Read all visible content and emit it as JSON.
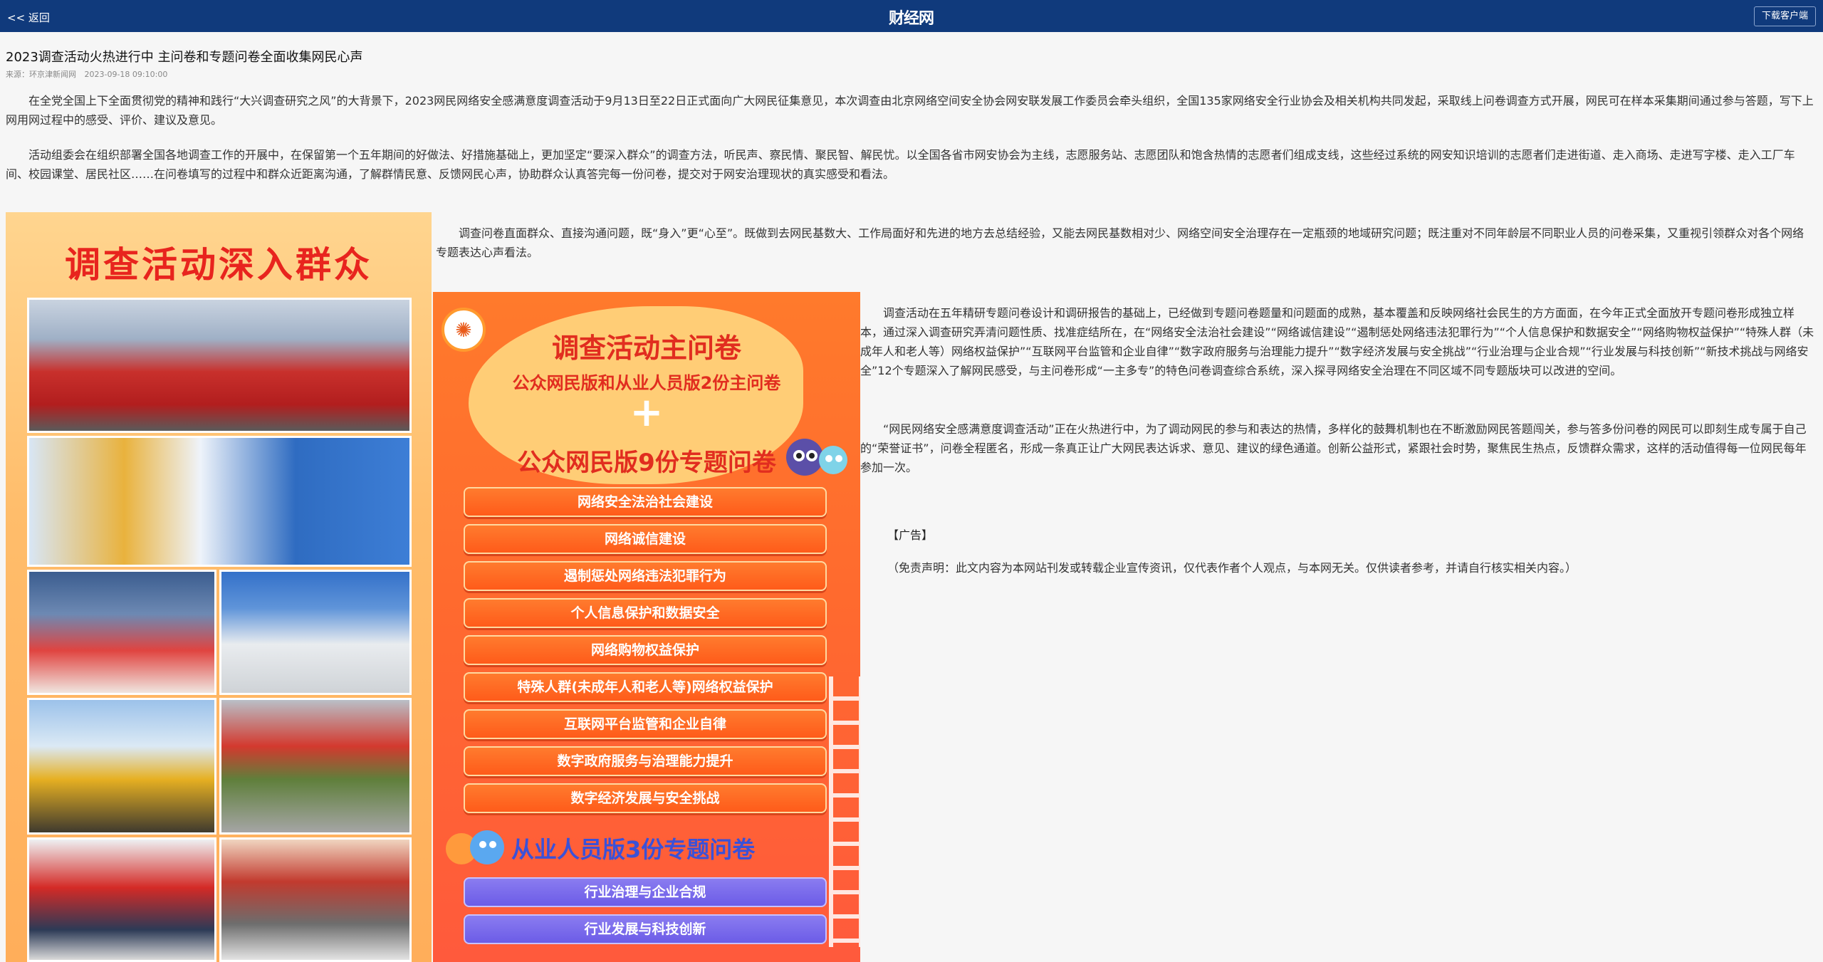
{
  "topbar": {
    "back_label": "<< 返回",
    "logo": "财经网",
    "download_label": "下载客户端"
  },
  "article": {
    "title": "2023调查活动火热进行中 主问卷和专题问卷全面收集网民心声",
    "source": "来源：环京津新闻网",
    "datetime": "2023-09-18 09:10:00",
    "paragraphs": [
      "在全党全国上下全面贯彻党的精神和践行“大兴调查研究之风”的大背景下，2023网民网络安全感满意度调查活动于9月13日至22日正式面向广大网民征集意见，本次调查由北京网络空间安全协会网安联发展工作委员会牵头组织，全国135家网络安全行业协会及相关机构共同发起，采取线上问卷调查方式开展，网民可在样本采集期间通过参与答题，写下上网用网过程中的感受、评价、建议及意见。",
      "活动组委会在组织部署全国各地调查工作的开展中，在保留第一个五年期间的好做法、好措施基础上，更加坚定“要深入群众”的调查方法，听民声、察民情、聚民智、解民忧。以全国各省市网安协会为主线，志愿服务站、志愿团队和饱含热情的志愿者们组成支线，这些经过系统的网安知识培训的志愿者们走进街道、走入商场、走进写字楼、走入工厂车间、校园课堂、居民社区……在问卷填写的过程中和群众近距离沟通，了解群情民意、反馈网民心声，协助群众认真答完每一份问卷，提交对于网安治理现状的真实感受和看法。",
      "调查问卷直面群众、直接沟通问题，既“身入”更“心至”。既做到去网民基数大、工作局面好和先进的地方去总结经验，又能去网民基数相对少、网络空间安全治理存在一定瓶颈的地域研究问题；既注重对不同年龄层不同职业人员的问卷采集，又重视引领群众对各个网络专题表达心声看法。",
      "调查活动在五年精研专题问卷设计和调研报告的基础上，已经做到专题问卷题量和问题面的成熟，基本覆盖和反映网络社会民生的方方面面，在今年正式全面放开专题问卷形成独立样本，通过深入调查研究弄清问题性质、找准症结所在，在“网络安全法治社会建设”“网络诚信建设”“遏制惩处网络违法犯罪行为”“个人信息保护和数据安全”“网络购物权益保护”“特殊人群（未成年人和老人等）网络权益保护”“互联网平台监管和企业自律”“数字政府服务与治理能力提升”“数字经济发展与安全挑战”“行业治理与企业合规”“行业发展与科技创新”“新技术挑战与网络安全”12个专题深入了解网民感受，与主问卷形成“一主多专”的特色问卷调查综合系统，深入探寻网络安全治理在不同区域不同专题版块可以改进的空间。",
      "“网民网络安全感满意度调查活动”正在火热进行中，为了调动网民的参与和表达的热情，多样化的鼓舞机制也在不断激励网民答题闯关，参与答多份问卷的网民可以即刻生成专属于自己的“荣誉证书”，问卷全程匿名，形成一条真正让广大网民表达诉求、意见、建议的绿色通道。创新公益形式，紧跟社会时势，聚焦民生热点，反馈群众需求，这样的活动值得每一位网民每年参加一次。"
    ],
    "ad_label": "【广告】",
    "disclaimer": "（免责声明：此文内容为本网站刊发或转载企业宣传资讯，仅代表作者个人观点，与本网无关。仅供读者参考，并请自行核实相关内容。）"
  },
  "poster_left": {
    "title": "调查活动深入群众"
  },
  "poster_right": {
    "heading": "调查活动主问卷",
    "subheading": "公众网民版和从业人员版2份主问卷",
    "plus": "+",
    "heading2": "公众网民版9份专题问卷",
    "topics": [
      "网络安全法治社会建设",
      "网络诚信建设",
      "遏制惩处网络违法犯罪行为",
      "个人信息保护和数据安全",
      "网络购物权益保护",
      "特殊人群(未成年人和老人等)网络权益保护",
      "互联网平台监管和企业自律",
      "数字政府服务与治理能力提升",
      "数字经济发展与安全挑战"
    ],
    "heading3": "从业人员版3份专题问卷",
    "topics2": [
      "行业治理与企业合规",
      "行业发展与科技创新"
    ]
  }
}
